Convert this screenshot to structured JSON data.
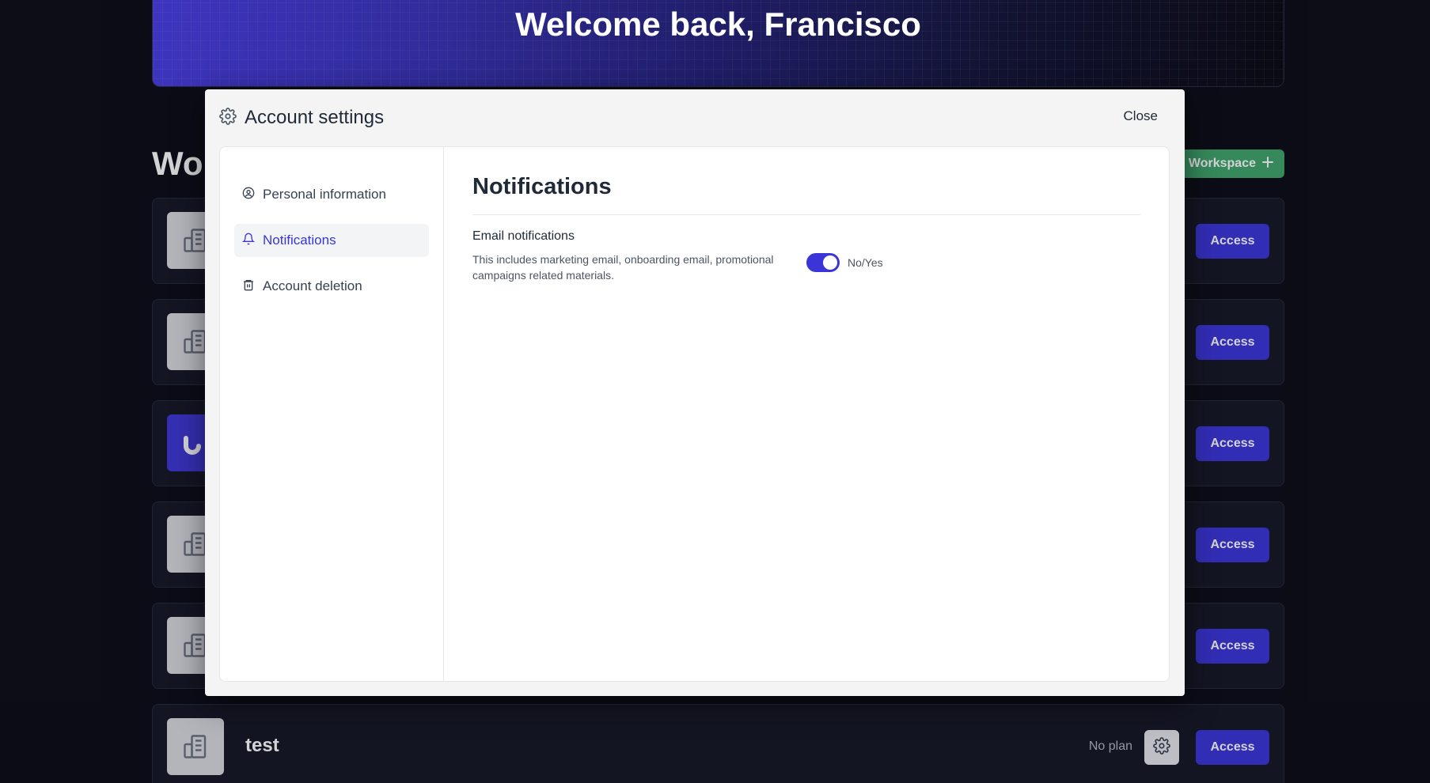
{
  "hero": {
    "title": "Welcome back, Francisco"
  },
  "workspaces": {
    "heading": "Wo",
    "new_button_label": "Workspace",
    "rows": [
      {
        "avatar": "building-icon",
        "access_label": "Access"
      },
      {
        "avatar": "building-icon",
        "access_label": "Access"
      },
      {
        "avatar": "brand-logo",
        "access_label": "Access"
      },
      {
        "avatar": "building-icon",
        "access_label": "Access"
      },
      {
        "avatar": "building-icon",
        "access_label": "Access"
      },
      {
        "avatar": "building-icon",
        "name": "test",
        "plan": "No plan",
        "access_label": "Access"
      }
    ]
  },
  "modal": {
    "title": "Account settings",
    "close_label": "Close",
    "sidebar": {
      "items": [
        {
          "label": "Personal information",
          "icon": "user-circle-icon",
          "active": false
        },
        {
          "label": "Notifications",
          "icon": "bell-icon",
          "active": true
        },
        {
          "label": "Account deletion",
          "icon": "trash-icon",
          "active": false
        }
      ]
    },
    "section": {
      "title": "Notifications",
      "email": {
        "label": "Email notifications",
        "description": "This includes marketing email, onboarding email, promotional campaigns related materials.",
        "toggle_label": "No/Yes",
        "enabled": true
      }
    }
  },
  "colors": {
    "accent": "#3b35d8",
    "success": "#3fa56b",
    "page_bg": "#0c0d16"
  }
}
